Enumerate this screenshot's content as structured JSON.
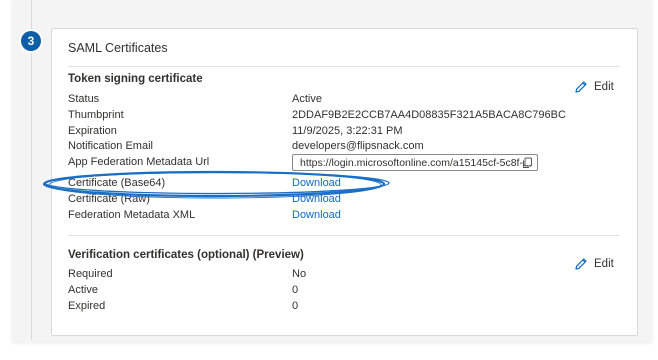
{
  "step": {
    "number": "3"
  },
  "card": {
    "title": "SAML Certificates",
    "token_section": {
      "title": "Token signing certificate",
      "edit_label": "Edit",
      "rows": [
        {
          "label": "Status",
          "value": "Active"
        },
        {
          "label": "Thumbprint",
          "value": "2DDAF9B2E2CCB7AA4D08835F321A5BACA8C796BC"
        },
        {
          "label": "Expiration",
          "value": "11/9/2025, 3:22:31 PM"
        },
        {
          "label": "Notification Email",
          "value": "developers@flipsnack.com"
        },
        {
          "label": "App Federation Metadata Url",
          "value": "https://login.microsoftonline.com/a15145cf-5c8f-..."
        },
        {
          "label": "Certificate (Base64)",
          "value": "Download"
        },
        {
          "label": "Certificate (Raw)",
          "value": "Download"
        },
        {
          "label": "Federation Metadata XML",
          "value": "Download"
        }
      ]
    },
    "verification_section": {
      "title": "Verification certificates (optional) (Preview)",
      "edit_label": "Edit",
      "rows": [
        {
          "label": "Required",
          "value": "No"
        },
        {
          "label": "Active",
          "value": "0"
        },
        {
          "label": "Expired",
          "value": "0"
        }
      ]
    }
  },
  "colors": {
    "accent": "#0f6cbd",
    "step_badge": "#0f5ea8",
    "annotation": "#1a6fc4"
  },
  "icons": [
    "pencil-icon",
    "copy-icon"
  ]
}
